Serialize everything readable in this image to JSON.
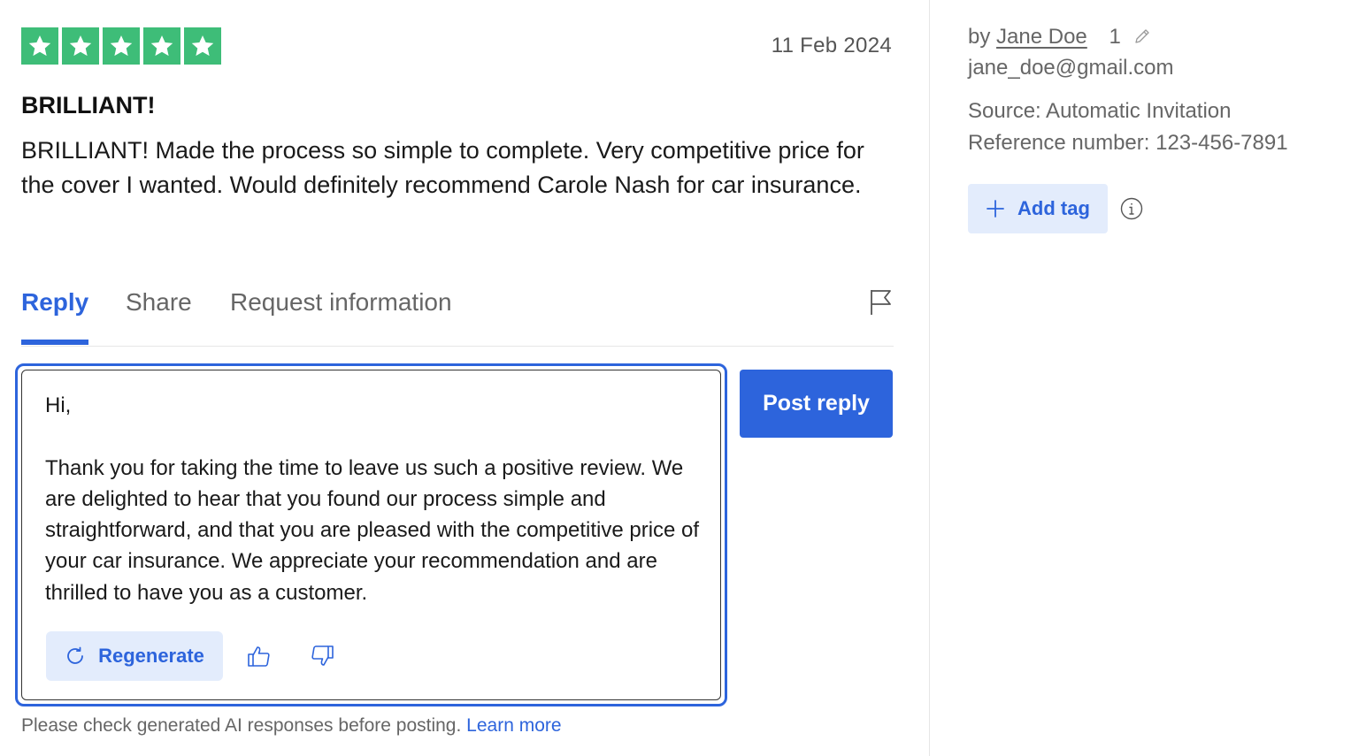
{
  "review": {
    "rating": 5,
    "max_rating": 5,
    "star_color": "#3ebd78",
    "date": "11 Feb 2024",
    "title": "BRILLIANT!",
    "body": "BRILLIANT! Made the process so simple to complete. Very competitive price for the cover I wanted. Would definitely recommend Carole Nash for car insurance."
  },
  "tabs": [
    {
      "label": "Reply",
      "active": true
    },
    {
      "label": "Share",
      "active": false
    },
    {
      "label": "Request information",
      "active": false
    }
  ],
  "reply": {
    "text": "Hi,\n\nThank you for taking the time to leave us such a positive review. We are delighted to hear that you found our process simple and straightforward, and that you are pleased with the competitive price of your car insurance. We appreciate your recommendation and are thrilled to have you as a customer.",
    "regenerate_label": "Regenerate",
    "post_label": "Post reply",
    "disclaimer": "Please check generated AI responses before posting.",
    "learn_more": "Learn more"
  },
  "sidebar": {
    "by_prefix": "by",
    "author": "Jane Doe",
    "review_count": "1",
    "email": "jane_doe@gmail.com",
    "source": "Source: Automatic Invitation",
    "reference": "Reference number: 123-456-7891",
    "add_tag_label": "Add tag"
  },
  "icons": {
    "star": "star-icon",
    "flag": "flag-icon",
    "refresh": "refresh-icon",
    "thumbs_up": "thumbs-up-icon",
    "thumbs_down": "thumbs-down-icon",
    "pencil": "pencil-icon",
    "plus": "plus-icon",
    "info": "info-icon"
  },
  "colors": {
    "accent": "#2d64dc",
    "accent_light": "#e3ecfc",
    "star_green": "#3ebd78",
    "muted_text": "#666666"
  }
}
